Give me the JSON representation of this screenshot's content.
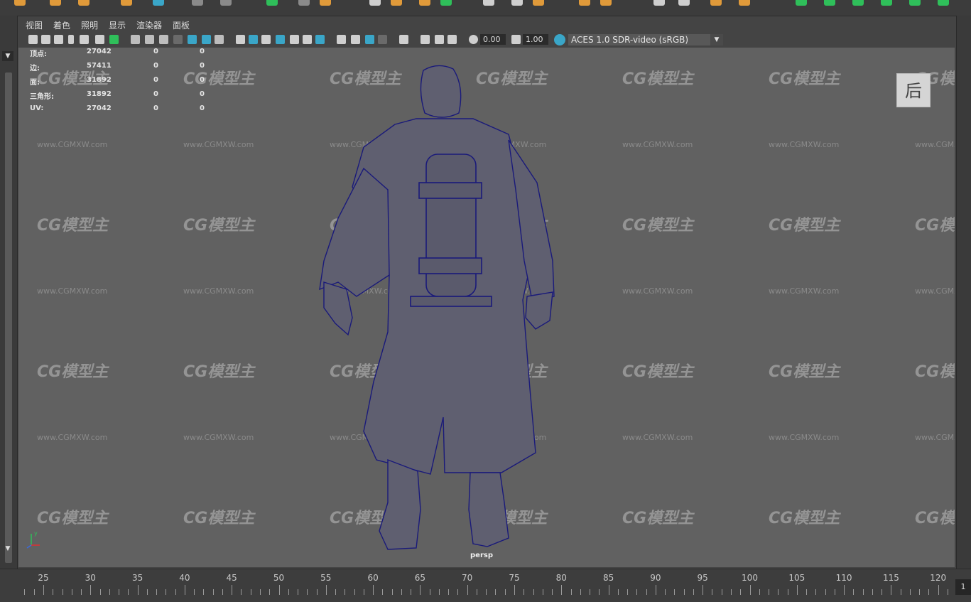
{
  "panel_menu": {
    "items": [
      "视图",
      "着色",
      "照明",
      "显示",
      "渲染器",
      "面板"
    ]
  },
  "toolbar": {
    "exposure_value": "0.00",
    "gamma_value": "1.00",
    "color_management": "ACES 1.0 SDR-video (sRGB)"
  },
  "hud": {
    "rows": [
      {
        "label": "顶点:",
        "value": "27042",
        "selected": "0",
        "uv": "0"
      },
      {
        "label": "边:",
        "value": "57411",
        "selected": "0",
        "uv": "0"
      },
      {
        "label": "面:",
        "value": "31892",
        "selected": "0",
        "uv": "0"
      },
      {
        "label": "三角形:",
        "value": "31892",
        "selected": "0",
        "uv": "0"
      },
      {
        "label": "UV:",
        "value": "27042",
        "selected": "0",
        "uv": "0"
      }
    ]
  },
  "viewport": {
    "camera_label": "persp",
    "view_cube_label": "后",
    "axis_y": "y",
    "wireframe_color": "#1a1a7a",
    "background_color": "#616161"
  },
  "watermark": {
    "logo_text": "CG模型主",
    "url_text": "www.CGMXW.com"
  },
  "timeline": {
    "tick_labels": [
      "25",
      "30",
      "35",
      "40",
      "45",
      "50",
      "55",
      "60",
      "65",
      "70",
      "75",
      "80",
      "85",
      "90",
      "95",
      "100",
      "105",
      "110",
      "115",
      "120"
    ],
    "current_frame": "1"
  },
  "colors": {
    "accent_green": "#2fbf5a",
    "accent_orange": "#e09a3a",
    "accent_cyan": "#3aa6c8"
  }
}
